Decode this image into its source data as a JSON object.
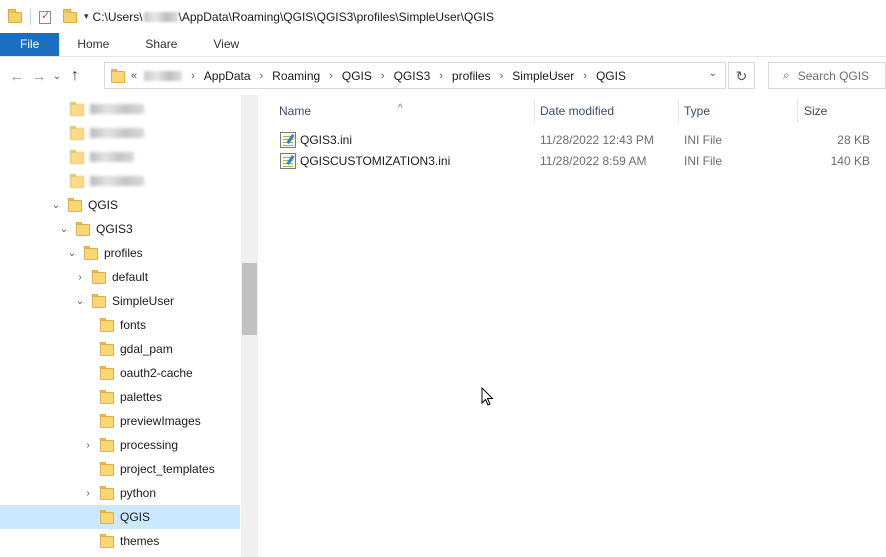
{
  "titlebar": {
    "path_prefix": "C:\\Users\\",
    "path_suffix": "\\AppData\\Roaming\\QGIS\\QGIS3\\profiles\\SimpleUser\\QGIS"
  },
  "ribbon": {
    "tabs": [
      "File",
      "Home",
      "Share",
      "View"
    ]
  },
  "address": {
    "overflow": "«",
    "crumbs": [
      "AppData",
      "Roaming",
      "QGIS",
      "QGIS3",
      "profiles",
      "SimpleUser",
      "QGIS"
    ]
  },
  "search": {
    "placeholder": "Search QGIS"
  },
  "tree": [
    {
      "label": "QGIS",
      "expanded": true
    },
    {
      "label": "QGIS3",
      "expanded": true
    },
    {
      "label": "profiles",
      "expanded": true
    },
    {
      "label": "default",
      "expanded": false
    },
    {
      "label": "SimpleUser",
      "expanded": true
    },
    {
      "label": "fonts"
    },
    {
      "label": "gdal_pam"
    },
    {
      "label": "oauth2-cache"
    },
    {
      "label": "palettes"
    },
    {
      "label": "previewImages"
    },
    {
      "label": "processing",
      "expanded": false
    },
    {
      "label": "project_templates"
    },
    {
      "label": "python",
      "expanded": false
    },
    {
      "label": "QGIS",
      "selected": true
    },
    {
      "label": "themes"
    }
  ],
  "columns": {
    "name": "Name",
    "date": "Date modified",
    "type": "Type",
    "size": "Size"
  },
  "files": [
    {
      "name": "QGIS3.ini",
      "date": "11/28/2022 12:43 PM",
      "type": "INI File",
      "size": "28 KB"
    },
    {
      "name": "QGISCUSTOMIZATION3.ini",
      "date": "11/28/2022 8:59 AM",
      "type": "INI File",
      "size": "140 KB"
    }
  ],
  "colors": {
    "file_tab": "#1a6fc0",
    "selection": "#cce8ff",
    "folder": "#f9d774",
    "header_text": "#3b4b6b"
  }
}
